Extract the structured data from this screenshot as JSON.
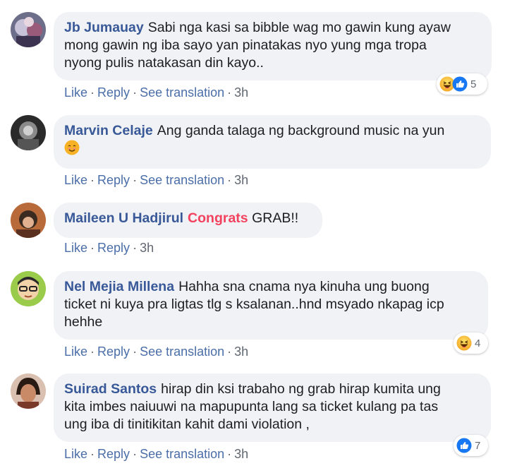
{
  "comments": [
    {
      "author": "Jb Jumauay",
      "text_lines": [
        "Sabi nga kasi sa bibble wag mo gawin kung ayaw",
        "mong gawin ng iba sayo yan pinatakas nyo yung mga tropa",
        "nyong pulis natakasan din kayo.."
      ],
      "actions": {
        "like": "Like",
        "reply": "Reply",
        "translate": "See translation",
        "time": "3h"
      },
      "reactions": {
        "icons": [
          "haha",
          "like"
        ],
        "count": "5"
      }
    },
    {
      "author": "Marvin Celaje",
      "text_lines": [
        "Ang ganda talaga ng background music na yun"
      ],
      "emoji_line": "smile-emoji",
      "actions": {
        "like": "Like",
        "reply": "Reply",
        "translate": "See translation",
        "time": "3h"
      }
    },
    {
      "author": "Maileen U Hadjirul",
      "highlight": "Congrats",
      "text_after": "GRAB!!",
      "actions": {
        "like": "Like",
        "reply": "Reply",
        "time": "3h"
      }
    },
    {
      "author": "Nel Mejia Millena",
      "text_lines": [
        "Hahha sna cnama nya kinuha ung buong",
        "ticket ni kuya pra ligtas tlg s ksalanan..hnd msyado nkapag icp",
        "hehhe"
      ],
      "actions": {
        "like": "Like",
        "reply": "Reply",
        "translate": "See translation",
        "time": "3h"
      },
      "reactions": {
        "icons": [
          "haha"
        ],
        "count": "4"
      }
    },
    {
      "author": "Suirad Santos",
      "text_lines": [
        "hirap din ksi trabaho ng grab hirap kumita ung",
        "kita imbes naiuuwi na mapupunta lang sa ticket kulang pa tas",
        "ung iba di tinitikitan kahit dami violation ,"
      ],
      "actions": {
        "like": "Like",
        "reply": "Reply",
        "translate": "See translation",
        "time": "3h"
      },
      "reactions": {
        "icons": [
          "like"
        ],
        "count": "7"
      }
    }
  ],
  "colors": {
    "author": "#385898",
    "bubble": "#f0f2f5",
    "highlight": "#f3425f",
    "like_blue": "#1877f2",
    "haha_yellow": "#f7b125"
  }
}
